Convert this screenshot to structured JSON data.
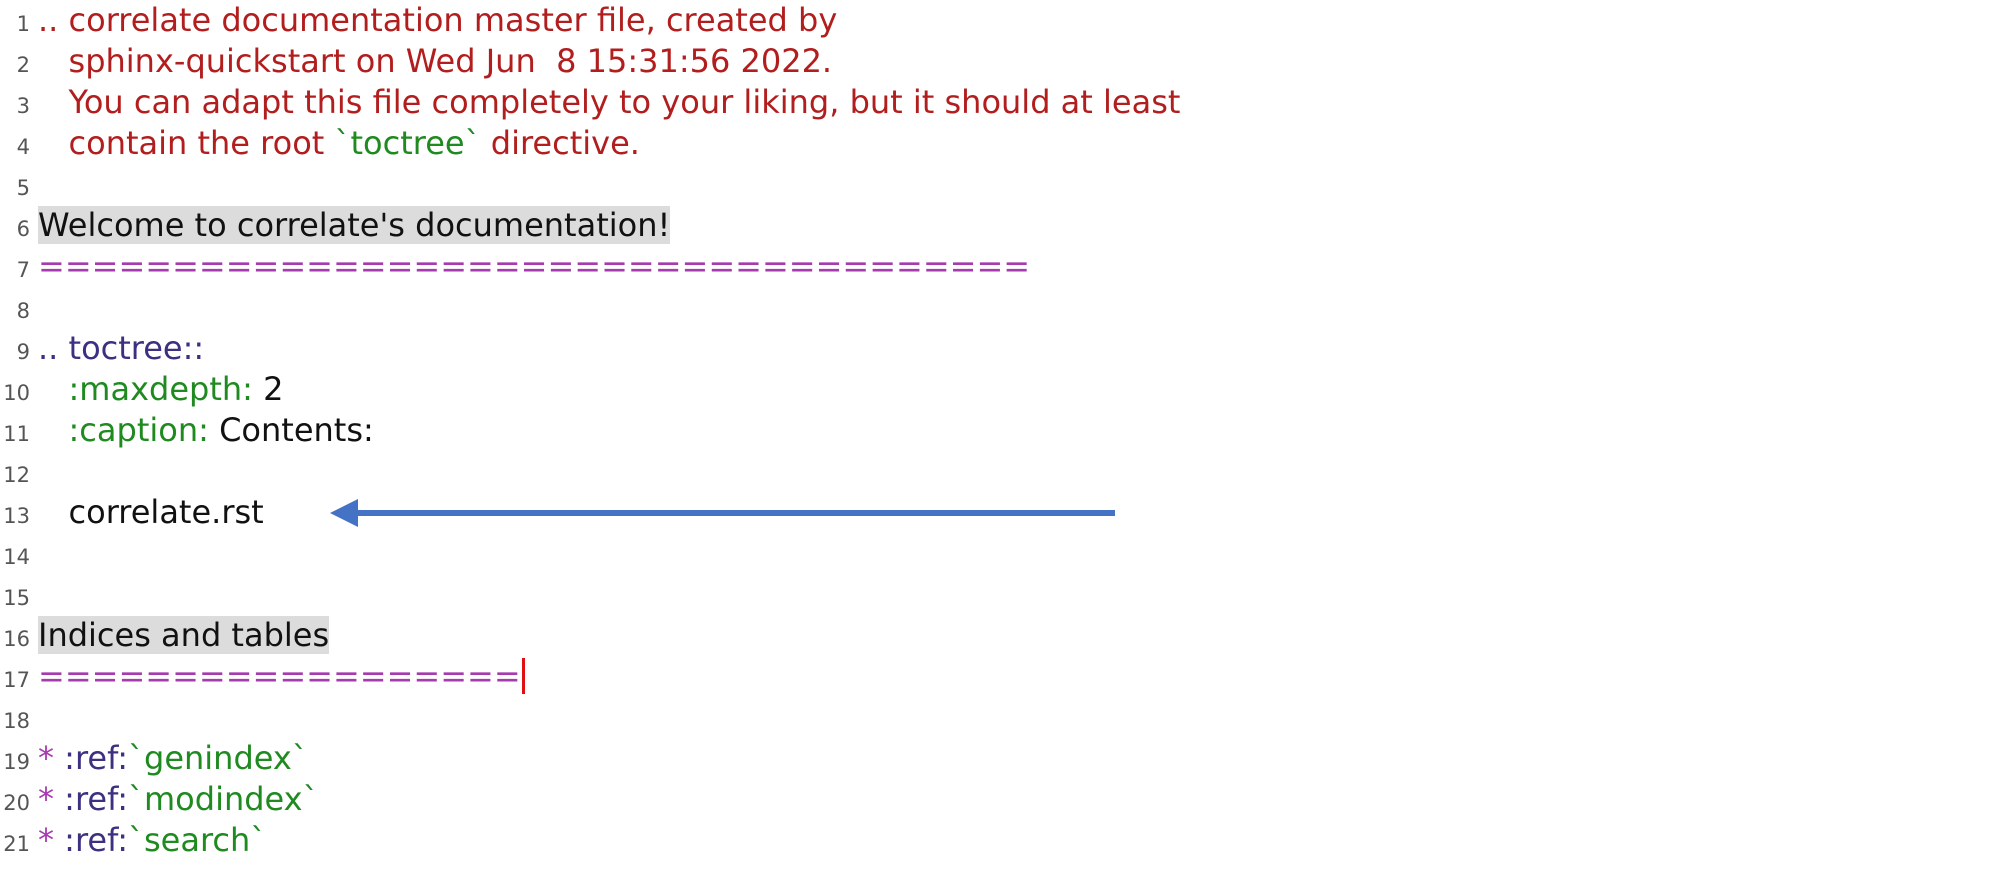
{
  "editor": {
    "lines": [
      {
        "num": "1",
        "segments": [
          {
            "text": ".. correlate documentation master file, created by",
            "color": "red"
          }
        ]
      },
      {
        "num": "2",
        "segments": [
          {
            "text": "   sphinx-quickstart on Wed Jun  8 15:31:56 2022.",
            "color": "red"
          }
        ]
      },
      {
        "num": "3",
        "segments": [
          {
            "text": "   You can adapt this file completely to your liking, but it should at least",
            "color": "red"
          }
        ]
      },
      {
        "num": "4",
        "segments": [
          {
            "text": "   contain the root ",
            "color": "red"
          },
          {
            "text": "`toctree`",
            "color": "green"
          },
          {
            "text": " directive.",
            "color": "red"
          }
        ]
      },
      {
        "num": "5",
        "segments": []
      },
      {
        "num": "6",
        "segments": [
          {
            "text": "Welcome to correlate's documentation!",
            "color": "black",
            "highlight": true
          }
        ]
      },
      {
        "num": "7",
        "segments": [
          {
            "text": "=====================================",
            "color": "purple"
          }
        ]
      },
      {
        "num": "8",
        "segments": []
      },
      {
        "num": "9",
        "segments": [
          {
            "text": ".. ",
            "color": "navy"
          },
          {
            "text": "toctree::",
            "color": "navy"
          }
        ]
      },
      {
        "num": "10",
        "segments": [
          {
            "text": "   ",
            "color": "black"
          },
          {
            "text": ":maxdepth:",
            "color": "green"
          },
          {
            "text": " 2",
            "color": "black"
          }
        ]
      },
      {
        "num": "11",
        "segments": [
          {
            "text": "   ",
            "color": "black"
          },
          {
            "text": ":caption:",
            "color": "green"
          },
          {
            "text": " Contents:",
            "color": "black"
          }
        ]
      },
      {
        "num": "12",
        "segments": []
      },
      {
        "num": "13",
        "segments": [
          {
            "text": "   correlate.rst",
            "color": "black"
          }
        ]
      },
      {
        "num": "14",
        "segments": []
      },
      {
        "num": "15",
        "segments": []
      },
      {
        "num": "16",
        "segments": [
          {
            "text": "Indices and tables",
            "color": "black",
            "highlight": true
          }
        ]
      },
      {
        "num": "17",
        "segments": [
          {
            "text": "==================",
            "color": "purple"
          }
        ],
        "caret": true
      },
      {
        "num": "18",
        "segments": []
      },
      {
        "num": "19",
        "segments": [
          {
            "text": "* ",
            "color": "purple"
          },
          {
            "text": ":ref:",
            "color": "navy"
          },
          {
            "text": "`genindex`",
            "color": "green"
          }
        ]
      },
      {
        "num": "20",
        "segments": [
          {
            "text": "* ",
            "color": "purple"
          },
          {
            "text": ":ref:",
            "color": "navy"
          },
          {
            "text": "`modindex`",
            "color": "green"
          }
        ]
      },
      {
        "num": "21",
        "segments": [
          {
            "text": "* ",
            "color": "purple"
          },
          {
            "text": ":ref:",
            "color": "navy"
          },
          {
            "text": "`search`",
            "color": "green"
          }
        ]
      }
    ]
  },
  "annotation": {
    "arrow_color": "#4472c4",
    "points_to_line": "13"
  },
  "colors": {
    "red": "#b21e1e",
    "green": "#1f8a1f",
    "purple": "#a63aaf",
    "navy": "#3b3180",
    "black": "#111111",
    "caret": "#e01010",
    "highlight": "#dcdcdc"
  }
}
